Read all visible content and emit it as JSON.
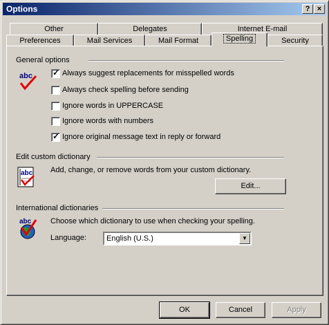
{
  "window": {
    "title": "Options"
  },
  "titlebar_buttons": {
    "help": "?",
    "close": "×"
  },
  "tabs_back": [
    {
      "label": "Other"
    },
    {
      "label": "Delegates"
    },
    {
      "label": "Internet E-mail"
    }
  ],
  "tabs_front": [
    {
      "label": "Preferences"
    },
    {
      "label": "Mail Services"
    },
    {
      "label": "Mail Format"
    },
    {
      "label": "Spelling"
    },
    {
      "label": "Security"
    }
  ],
  "general": {
    "heading": "General options",
    "options": [
      {
        "label": "Always suggest replacements for misspelled words",
        "checked": true
      },
      {
        "label": "Always check spelling before sending",
        "checked": false
      },
      {
        "label": "Ignore words in UPPERCASE",
        "checked": false
      },
      {
        "label": "Ignore words with numbers",
        "checked": false
      },
      {
        "label": "Ignore original message text in reply or forward",
        "checked": true
      }
    ]
  },
  "custom_dict": {
    "heading": "Edit custom dictionary",
    "description": "Add, change, or remove words from your custom dictionary.",
    "edit_label": "Edit..."
  },
  "intl": {
    "heading": "International dictionaries",
    "description": "Choose which dictionary to use when checking your spelling.",
    "language_label": "Language:",
    "language_value": "English (U.S.)"
  },
  "icon_text": "abc",
  "footer": {
    "ok": "OK",
    "cancel": "Cancel",
    "apply": "Apply"
  },
  "check_glyph": "✓"
}
